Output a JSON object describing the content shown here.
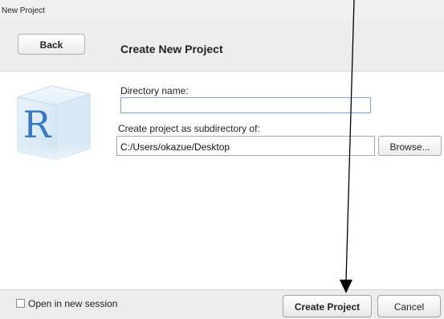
{
  "window": {
    "title": "New Project"
  },
  "header": {
    "back_label": "Back",
    "title": "Create New Project"
  },
  "form": {
    "directory_label": "Directory name:",
    "directory_value": "",
    "subdirectory_label": "Create project as subdirectory of:",
    "subdirectory_path": "C:/Users/okazue/Desktop",
    "browse_label": "Browse..."
  },
  "footer": {
    "open_new_session_label": "Open in new session",
    "open_new_session_checked": false,
    "create_label": "Create Project",
    "cancel_label": "Cancel"
  },
  "logo": {
    "letter": "R"
  },
  "colors": {
    "accent_input_border": "#7aa7d6",
    "logo_blue": "#3a78c2"
  }
}
